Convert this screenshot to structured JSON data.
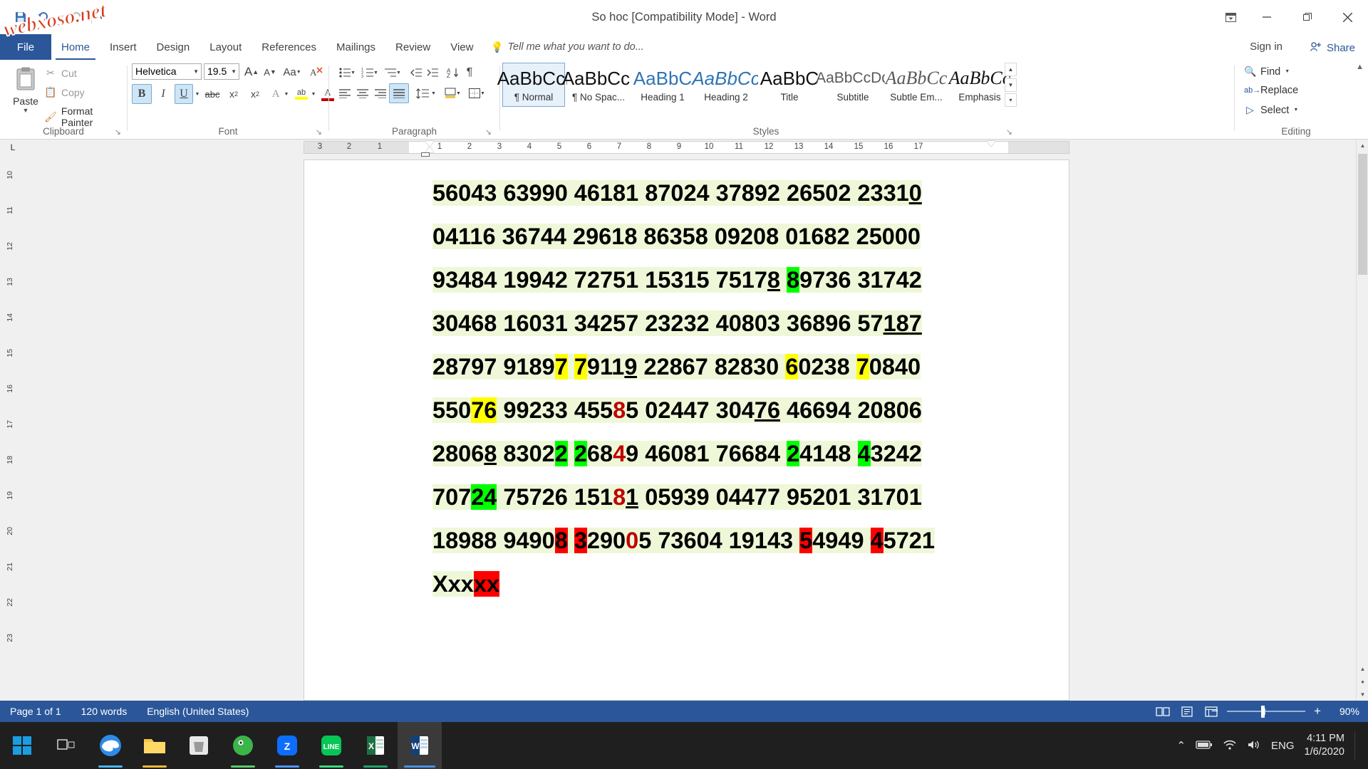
{
  "window": {
    "title": "So hoc [Compatibility Mode] - Word",
    "quick_access": [
      {
        "name": "save-icon",
        "glyph": "💾"
      },
      {
        "name": "undo-icon",
        "glyph": "↶"
      },
      {
        "name": "undo-dropdown-icon",
        "glyph": "▾"
      },
      {
        "name": "redo-icon",
        "glyph": "↷"
      },
      {
        "name": "customize-qat-icon",
        "glyph": "▾"
      }
    ],
    "controls": {
      "ribbon_display": "⬆",
      "minimize": "─",
      "restore": "❐",
      "close": "✕"
    },
    "watermark": "webxoso.net"
  },
  "tabs": {
    "file": "File",
    "items": [
      "Home",
      "Insert",
      "Design",
      "Layout",
      "References",
      "Mailings",
      "Review",
      "View"
    ],
    "active": "Home",
    "tell_me": "Tell me what you want to do...",
    "sign_in": "Sign in",
    "share": "Share"
  },
  "ribbon": {
    "groups": [
      "Clipboard",
      "Font",
      "Paragraph",
      "Styles",
      "Editing"
    ],
    "clipboard": {
      "paste_label": "Paste",
      "cut": "Cut",
      "copy": "Copy",
      "format_painter": "Format Painter"
    },
    "font": {
      "font_name": "Helvetica",
      "font_size": "19.5",
      "grow_font": "A",
      "shrink_font": "A",
      "change_case": "Aa",
      "clear_formatting": "✒",
      "bold": "B",
      "italic": "I",
      "underline": "U",
      "strikethrough": "abc",
      "subscript": "X₂",
      "superscript": "X²",
      "text_effects": "A",
      "highlight": "ab",
      "font_color": "A"
    },
    "paragraph": {
      "bullets": "≡",
      "numbering": "≣",
      "multilevel": "≣",
      "decrease_indent": "⇤",
      "increase_indent": "⇥",
      "sort": "A↓",
      "show_marks": "¶",
      "align_left": "≡",
      "align_center": "≡",
      "align_right": "≡",
      "justify": "≡",
      "line_spacing": "↕",
      "shading": "▤",
      "borders": "▦"
    },
    "styles": [
      {
        "preview": "AaBbCcI",
        "name": "¶ Normal",
        "selected": true
      },
      {
        "preview": "AaBbCcI",
        "name": "¶ No Spac...",
        "selected": false
      },
      {
        "preview": "AaBbC",
        "name": "Heading 1",
        "selected": false
      },
      {
        "preview": "AaBbCc",
        "name": "Heading 2",
        "selected": false
      },
      {
        "preview": "AaBbC",
        "name": "Title",
        "selected": false
      },
      {
        "preview": "AaBbCcDd",
        "name": "Subtitle",
        "selected": false
      },
      {
        "preview": "AaBbCc",
        "name": "Subtle Em...",
        "selected": false
      },
      {
        "preview": "AaBbCc",
        "name": "Emphasis",
        "selected": false
      }
    ],
    "editing": {
      "find": "Find",
      "replace": "Replace",
      "select": "Select"
    }
  },
  "ruler": {
    "corner_tab": "L",
    "h_left_numbers": [
      "3",
      "2",
      "1"
    ],
    "h_right_numbers": [
      "1",
      "2",
      "3",
      "4",
      "5",
      "6",
      "7",
      "8",
      "9",
      "10",
      "11",
      "12",
      "13",
      "14",
      "15",
      "16",
      "17"
    ],
    "v_numbers": [
      "10",
      "11",
      "12",
      "13",
      "14",
      "15",
      "16",
      "17",
      "18",
      "19",
      "20",
      "21",
      "22",
      "23"
    ]
  },
  "document": {
    "lines": [
      {
        "id": "line-1",
        "runs": [
          {
            "t": "56043 63990 46181 87024 37892 26502 2331",
            "hl": "pale"
          },
          {
            "t": "0",
            "hl": "pale",
            "underline": true
          }
        ]
      },
      {
        "id": "line-2",
        "runs": [
          {
            "t": "04116 36744 29618 86358 09208 01682 25000",
            "hl": "pale"
          }
        ]
      },
      {
        "id": "line-3",
        "runs": [
          {
            "t": "93484 19942 72751 15315 7517",
            "hl": "pale"
          },
          {
            "t": "8",
            "hl": "pale",
            "underline": true
          },
          {
            "t": " ",
            "hl": "pale"
          },
          {
            "t": "8",
            "hl": "green"
          },
          {
            "t": "9736 31742",
            "hl": "pale"
          }
        ]
      },
      {
        "id": "line-4",
        "runs": [
          {
            "t": "30468 16031 34257 23232 40803 36896 57",
            "hl": "pale"
          },
          {
            "t": "187",
            "hl": "pale",
            "underline": true
          }
        ]
      },
      {
        "id": "line-5",
        "runs": [
          {
            "t": "28797 9189",
            "hl": "pale"
          },
          {
            "t": "7",
            "hl": "yellow"
          },
          {
            "t": " ",
            "hl": "pale"
          },
          {
            "t": "7",
            "hl": "yellow"
          },
          {
            "t": "911",
            "hl": "pale"
          },
          {
            "t": "9",
            "hl": "pale",
            "underline": true
          },
          {
            "t": " 22867 82830 ",
            "hl": "pale"
          },
          {
            "t": "6",
            "hl": "yellow"
          },
          {
            "t": "0238 ",
            "hl": "pale"
          },
          {
            "t": "7",
            "hl": "yellow"
          },
          {
            "t": "0840",
            "hl": "pale"
          }
        ]
      },
      {
        "id": "line-6",
        "runs": [
          {
            "t": "550",
            "hl": "pale"
          },
          {
            "t": "76",
            "hl": "yellow"
          },
          {
            "t": " 99233 455",
            "hl": "pale"
          },
          {
            "t": "8",
            "hl": "pale",
            "color": "red"
          },
          {
            "t": "5 02447 304",
            "hl": "pale"
          },
          {
            "t": "76",
            "hl": "pale",
            "underline": true
          },
          {
            "t": " 46694 20806",
            "hl": "pale"
          }
        ]
      },
      {
        "id": "line-7",
        "runs": [
          {
            "t": "2806",
            "hl": "pale"
          },
          {
            "t": "8",
            "hl": "pale",
            "underline": true
          },
          {
            "t": " 8302",
            "hl": "pale"
          },
          {
            "t": "2",
            "hl": "green"
          },
          {
            "t": " ",
            "hl": "pale"
          },
          {
            "t": "2",
            "hl": "green"
          },
          {
            "t": "68",
            "hl": "pale"
          },
          {
            "t": "4",
            "hl": "pale",
            "color": "red"
          },
          {
            "t": "9 46081 76684 ",
            "hl": "pale"
          },
          {
            "t": "2",
            "hl": "green"
          },
          {
            "t": "4148 ",
            "hl": "pale"
          },
          {
            "t": "4",
            "hl": "green"
          },
          {
            "t": "3242",
            "hl": "pale"
          }
        ]
      },
      {
        "id": "line-8",
        "runs": [
          {
            "t": "707",
            "hl": "pale"
          },
          {
            "t": "24",
            "hl": "green"
          },
          {
            "t": " 75726 151",
            "hl": "pale"
          },
          {
            "t": "8",
            "hl": "pale",
            "color": "red"
          },
          {
            "t": "1",
            "hl": "pale",
            "underline": true
          },
          {
            "t": " 05939 04477 95201 31701",
            "hl": "pale"
          }
        ]
      },
      {
        "id": "line-9",
        "runs": [
          {
            "t": "18988 9490",
            "hl": "pale"
          },
          {
            "t": "8",
            "hl": "red"
          },
          {
            "t": " ",
            "hl": "pale"
          },
          {
            "t": "3",
            "hl": "red"
          },
          {
            "t": "290",
            "hl": "pale"
          },
          {
            "t": "0",
            "hl": "pale",
            "color": "red"
          },
          {
            "t": "5 73604 19143 ",
            "hl": "pale"
          },
          {
            "t": "5",
            "hl": "red"
          },
          {
            "t": "4949 ",
            "hl": "pale"
          },
          {
            "t": "4",
            "hl": "red"
          },
          {
            "t": "5721",
            "hl": "pale"
          }
        ]
      },
      {
        "id": "line-10",
        "runs": [
          {
            "t": "Xxx",
            "hl": "pale"
          },
          {
            "t": "xx",
            "hl": "red"
          }
        ]
      }
    ]
  },
  "status": {
    "page": "Page 1 of 1",
    "words": "120 words",
    "language": "English (United States)",
    "views": [
      "read-mode-icon",
      "print-layout-icon",
      "web-layout-icon"
    ],
    "zoom_out": "−",
    "zoom_in": "+",
    "zoom_pct": "90%"
  },
  "taskbar": {
    "start": "start-icon",
    "items": [
      {
        "name": "task-view",
        "label": "Task View"
      },
      {
        "name": "edge",
        "label": "Microsoft Edge"
      },
      {
        "name": "file-explorer",
        "label": "File Explorer"
      },
      {
        "name": "store",
        "label": "Microsoft Store"
      },
      {
        "name": "coccoc",
        "label": "Coc Coc"
      },
      {
        "name": "zalo",
        "label": "Zalo"
      },
      {
        "name": "line",
        "label": "LINE"
      },
      {
        "name": "excel",
        "label": "Excel"
      },
      {
        "name": "word",
        "label": "Word"
      }
    ],
    "tray": {
      "chevron": "⌃",
      "battery": "battery-icon",
      "network": "network-icon",
      "volume": "volume-icon",
      "language": "ENG",
      "time": "4:11 PM",
      "date": "1/6/2020"
    }
  },
  "colors": {
    "accent": "#2b579a",
    "highlight_pale": "#eef8d8",
    "highlight_green": "#00ff00",
    "highlight_yellow": "#ffff00",
    "highlight_red": "#ff0000",
    "text_red": "#c00000"
  }
}
